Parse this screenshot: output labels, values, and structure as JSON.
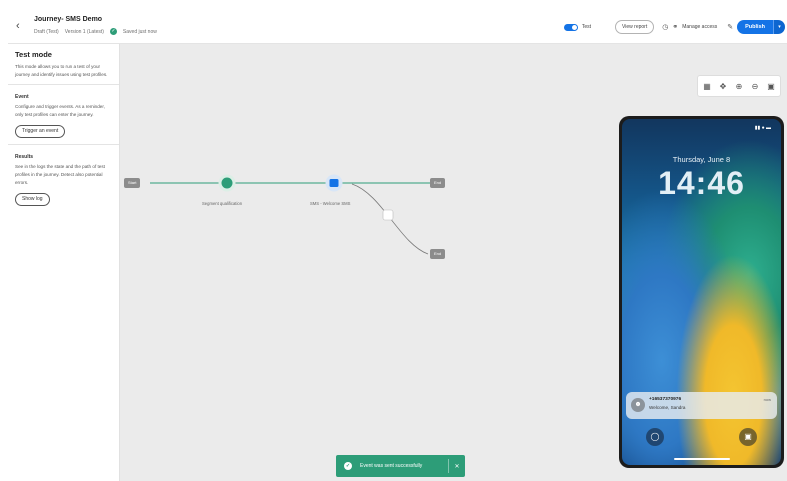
{
  "header": {
    "title": "Journey- SMS Demo",
    "status": "Draft (Test)",
    "version": "Version 1 (Latest)",
    "saved": "Saved just now",
    "test_label": "Test",
    "view_report": "View report",
    "manage_access": "Manage access",
    "publish": "Publish"
  },
  "panel": {
    "title": "Test mode",
    "intro": "This mode allows you to run a test of your journey and identify issues using test profiles.",
    "event_heading": "Event",
    "event_text": "Configure and trigger events. As a reminder, only test profiles can enter the journey.",
    "trigger_button": "Trigger an event",
    "results_heading": "Results",
    "results_text": "See in the logs the state and the path of test profiles in the journey. Detect also potential errors.",
    "show_log_button": "Show log"
  },
  "canvas": {
    "start_chip": "Start",
    "node1_label": "Segment qualification",
    "node2_label": "SMS - Welcome SMS",
    "end_chip_1": "End",
    "end_chip_2": "End"
  },
  "phone": {
    "date": "Thursday, June 8",
    "time": "14:46",
    "sender": "+16537370976",
    "message": "Welcome, Sandra",
    "when": "now"
  },
  "toast": {
    "message": "Event was sent successfully"
  },
  "colors": {
    "accent": "#1473e6",
    "success": "#2d9d78",
    "path": "#2d9d78"
  }
}
